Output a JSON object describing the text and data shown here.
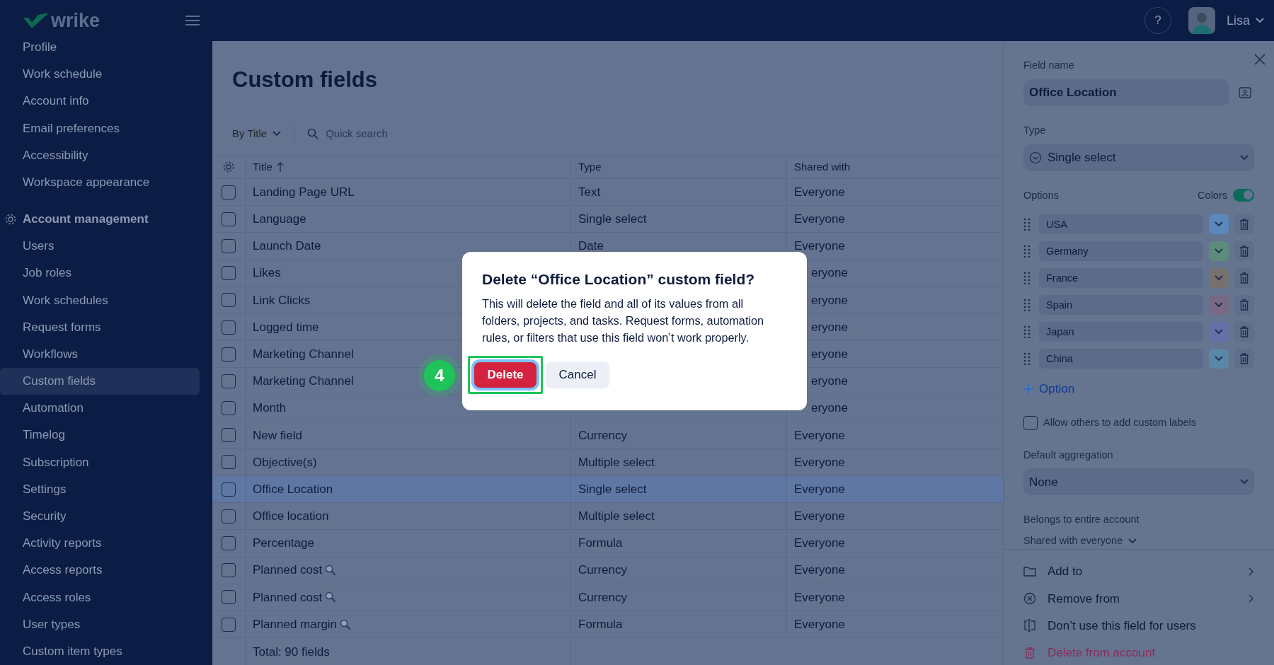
{
  "header": {
    "logo": "wrike",
    "help": "?",
    "user": "Lisa"
  },
  "sidebar": {
    "sections": [
      {
        "items": [
          {
            "label": "Profile",
            "selected": false
          },
          {
            "label": "Work schedule",
            "selected": false
          },
          {
            "label": "Account info",
            "selected": false
          },
          {
            "label": "Email preferences",
            "selected": false
          },
          {
            "label": "Accessibility",
            "selected": false
          },
          {
            "label": "Workspace appearance",
            "selected": false
          }
        ]
      },
      {
        "title": "Account management",
        "items": [
          {
            "label": "Users",
            "selected": false
          },
          {
            "label": "Job roles",
            "selected": false
          },
          {
            "label": "Work schedules",
            "selected": false
          },
          {
            "label": "Request forms",
            "selected": false
          },
          {
            "label": "Workflows",
            "selected": false
          },
          {
            "label": "Custom fields",
            "selected": true
          },
          {
            "label": "Automation",
            "selected": false
          },
          {
            "label": "Timelog",
            "selected": false
          },
          {
            "label": "Subscription",
            "selected": false
          },
          {
            "label": "Settings",
            "selected": false
          },
          {
            "label": "Security",
            "selected": false
          },
          {
            "label": "Activity reports",
            "selected": false
          },
          {
            "label": "Access reports",
            "selected": false
          },
          {
            "label": "Access roles",
            "selected": false
          },
          {
            "label": "User types",
            "selected": false
          },
          {
            "label": "Custom item types",
            "selected": false
          }
        ]
      }
    ]
  },
  "page": {
    "title": "Custom fields",
    "sort": "By Title",
    "search": {
      "placeholder": "Quick search"
    }
  },
  "table": {
    "columns": [
      {
        "label": "Title",
        "sorted": true
      },
      {
        "label": "Type",
        "sorted": false
      },
      {
        "label": "Shared with",
        "sorted": false
      }
    ],
    "rows": [
      {
        "title": "Landing Page URL",
        "type": "Text",
        "shared": "Everyone",
        "checked": false,
        "selected": false,
        "lookup": false
      },
      {
        "title": "Language",
        "type": "Single select",
        "shared": "Everyone",
        "checked": false,
        "selected": false,
        "lookup": false
      },
      {
        "title": "Launch Date",
        "type": "Date",
        "shared": "Everyone",
        "checked": false,
        "selected": false,
        "lookup": false
      },
      {
        "title": "Likes",
        "shared": "eryone",
        "checked": false,
        "selected": false,
        "lookup": false
      },
      {
        "title": "Link Clicks",
        "shared": "eryone",
        "checked": false,
        "selected": false,
        "lookup": false
      },
      {
        "title": "Logged time",
        "shared": "eryone",
        "checked": false,
        "selected": false,
        "lookup": false
      },
      {
        "title": "Marketing Channel",
        "shared": "eryone",
        "checked": false,
        "selected": false,
        "lookup": false
      },
      {
        "title": "Marketing Channel",
        "shared": "eryone",
        "checked": false,
        "selected": false,
        "lookup": false
      },
      {
        "title": "Month",
        "shared": "eryone",
        "checked": false,
        "selected": false,
        "lookup": false
      },
      {
        "title": "New field",
        "type": "Currency",
        "shared": "Everyone",
        "checked": false,
        "selected": false,
        "lookup": false
      },
      {
        "title": "Objective(s)",
        "type": "Multiple select",
        "shared": "Everyone",
        "checked": false,
        "selected": false,
        "lookup": false
      },
      {
        "title": "Office Location",
        "type": "Single select",
        "shared": "Everyone",
        "checked": false,
        "selected": true,
        "lookup": false
      },
      {
        "title": "Office location",
        "type": "Multiple select",
        "shared": "Everyone",
        "checked": false,
        "selected": false,
        "lookup": false
      },
      {
        "title": "Percentage",
        "type": "Formula",
        "shared": "Everyone",
        "checked": false,
        "selected": false,
        "lookup": false
      },
      {
        "title": "Planned cost",
        "type": "Currency",
        "shared": "Everyone",
        "checked": false,
        "selected": false,
        "lookup": true
      },
      {
        "title": "Planned cost",
        "type": "Currency",
        "shared": "Everyone",
        "checked": false,
        "selected": false,
        "lookup": true
      },
      {
        "title": "Planned margin",
        "type": "Formula",
        "shared": "Everyone",
        "checked": false,
        "selected": false,
        "lookup": true
      }
    ],
    "total": "Total: 90 fields"
  },
  "panel": {
    "field_name": {
      "label": "Field name",
      "value": "Office Location"
    },
    "type": {
      "label": "Type",
      "value": "Single select"
    },
    "options_label": "Options",
    "colors": {
      "label": "Colors",
      "on": true
    },
    "options": [
      {
        "label": "USA",
        "color": "#5b88bd"
      },
      {
        "label": "Germany",
        "color": "#5c8c7c"
      },
      {
        "label": "France",
        "color": "#76706e"
      },
      {
        "label": "Spain",
        "color": "#786a86"
      },
      {
        "label": "Japan",
        "color": "#6670a6"
      },
      {
        "label": "China",
        "color": "#5a86a8"
      }
    ],
    "add_option": "Option",
    "allow_labels": {
      "label": "Allow others to add custom labels",
      "checked": false
    },
    "aggregation": {
      "label": "Default aggregation",
      "value": "None"
    },
    "belongs": "Belongs to entire account",
    "sharing": "Shared with everyone",
    "actions": [
      {
        "label": "Add to",
        "kind": "add"
      },
      {
        "label": "Remove from",
        "kind": "remove"
      },
      {
        "label": "Don’t use this field for users",
        "kind": "disable"
      },
      {
        "label": "Delete from account",
        "kind": "delete"
      }
    ]
  },
  "dialog": {
    "title": "Delete “Office Location” custom field?",
    "body": "This will delete the field and all of its values from all folders, projects, and tasks. Request forms, automation rules, or filters that use this field won’t work properly.",
    "confirm": "Delete",
    "cancel": "Cancel",
    "step_badge": "4"
  }
}
